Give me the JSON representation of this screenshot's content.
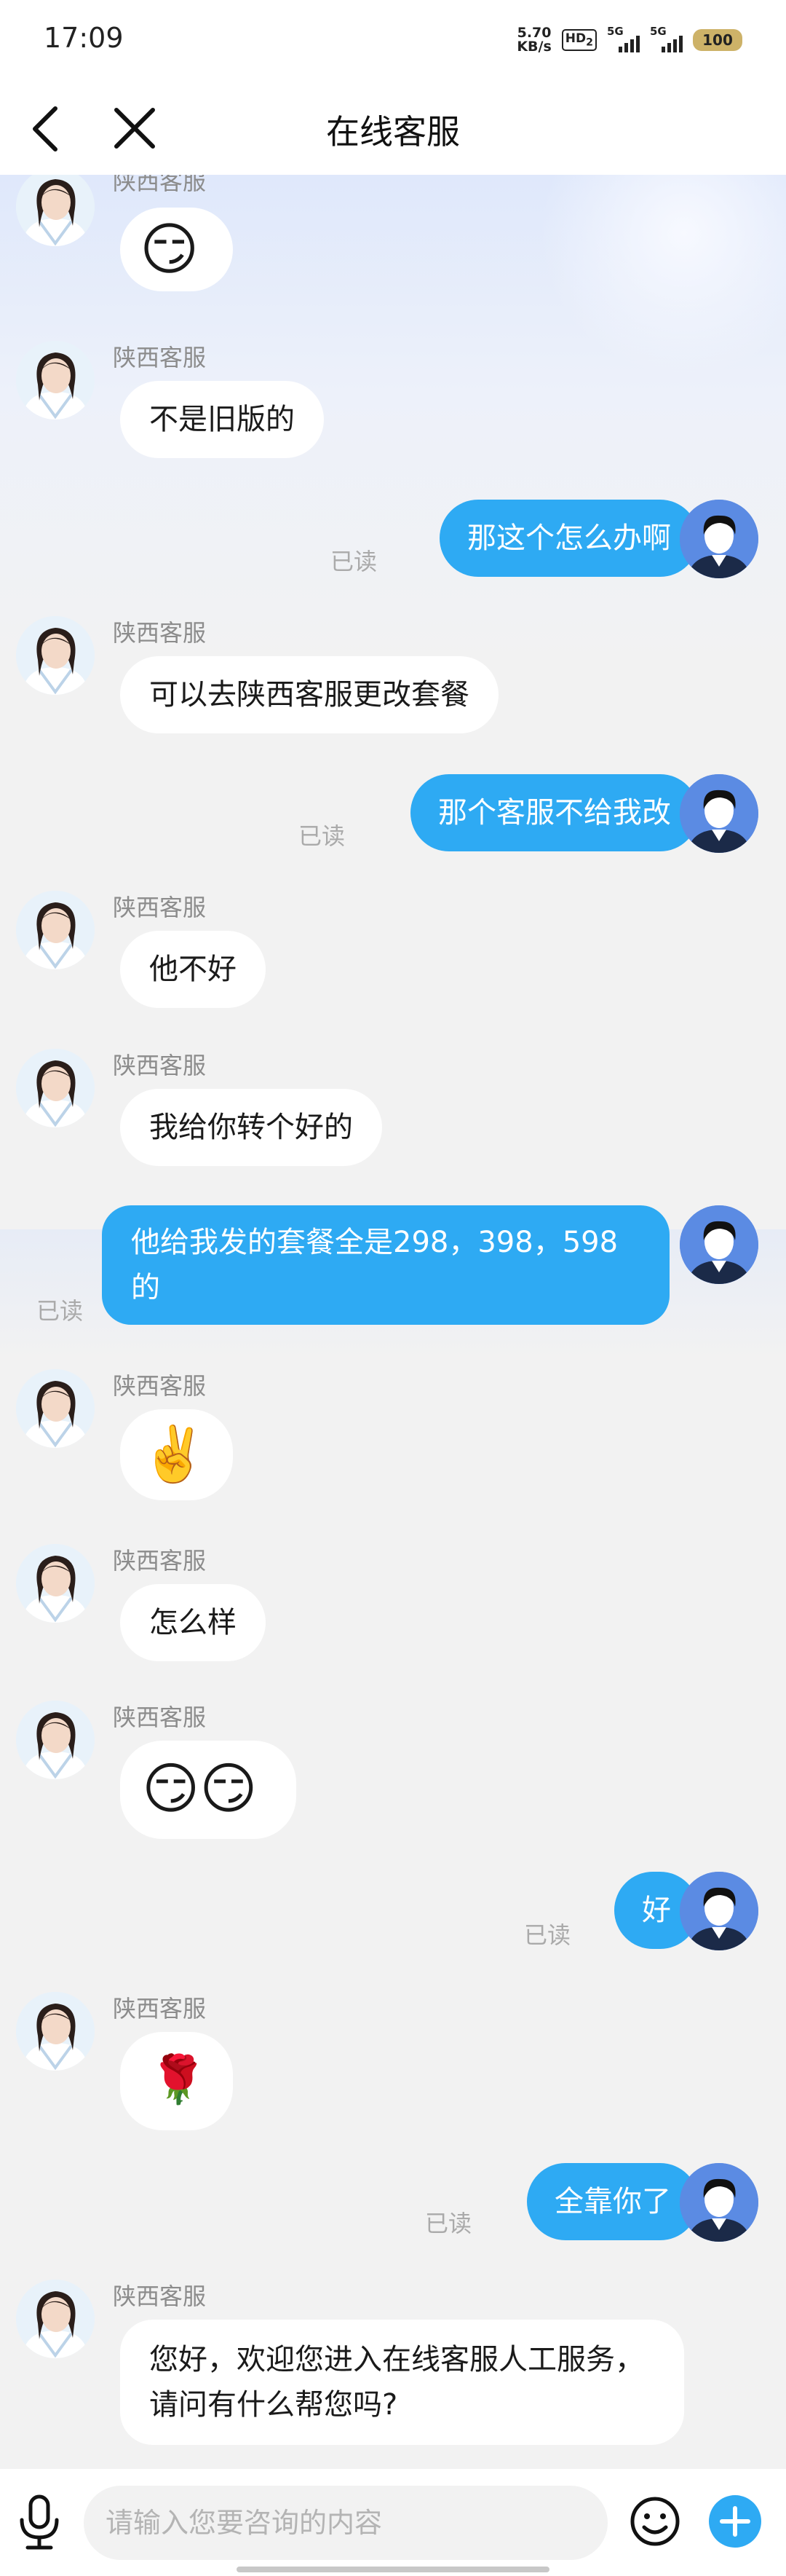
{
  "status_bar": {
    "time": "17:09",
    "speed_value": "5.70",
    "speed_unit": "KB/s",
    "hd_badge": "HD",
    "hd_sub": "2",
    "signal1_label": "5G",
    "signal2_label": "5G",
    "battery": "100"
  },
  "header": {
    "title": "在线客服",
    "back_icon": "chevron-left-icon",
    "close_icon": "close-icon"
  },
  "agent": {
    "name": "陕西客服"
  },
  "read_label": "已读",
  "messages": [
    {
      "from": "agent",
      "type": "emoji",
      "content": "😏"
    },
    {
      "from": "agent",
      "type": "text",
      "content": "不是旧版的"
    },
    {
      "from": "user",
      "type": "text",
      "content": "那这个怎么办啊"
    },
    {
      "from": "agent",
      "type": "text",
      "content": "可以去陕西客服更改套餐"
    },
    {
      "from": "user",
      "type": "text",
      "content": "那个客服不给我改"
    },
    {
      "from": "agent",
      "type": "text",
      "content": "他不好"
    },
    {
      "from": "agent",
      "type": "text",
      "content": "我给你转个好的"
    },
    {
      "from": "user",
      "type": "text",
      "content": "他给我发的套餐全是298，398，598的"
    },
    {
      "from": "agent",
      "type": "emoji",
      "content": "✌️"
    },
    {
      "from": "agent",
      "type": "text",
      "content": "怎么样"
    },
    {
      "from": "agent",
      "type": "emoji",
      "content": "😏😏"
    },
    {
      "from": "user",
      "type": "text",
      "content": "好"
    },
    {
      "from": "agent",
      "type": "emoji",
      "content": "🌹"
    },
    {
      "from": "user",
      "type": "text",
      "content": "全靠你了"
    },
    {
      "from": "agent",
      "type": "text",
      "content": "您好，欢迎您进入在线客服人工服务，请问有什么帮您吗?"
    }
  ],
  "input": {
    "placeholder": "请输入您要咨询的内容",
    "voice_icon": "microphone-icon",
    "emoji_icon": "smiley-icon",
    "more_icon": "plus-icon"
  },
  "colors": {
    "user_bubble": "#2eaaf3",
    "agent_bubble": "#ffffff",
    "plus_button": "#2eaaf3"
  }
}
